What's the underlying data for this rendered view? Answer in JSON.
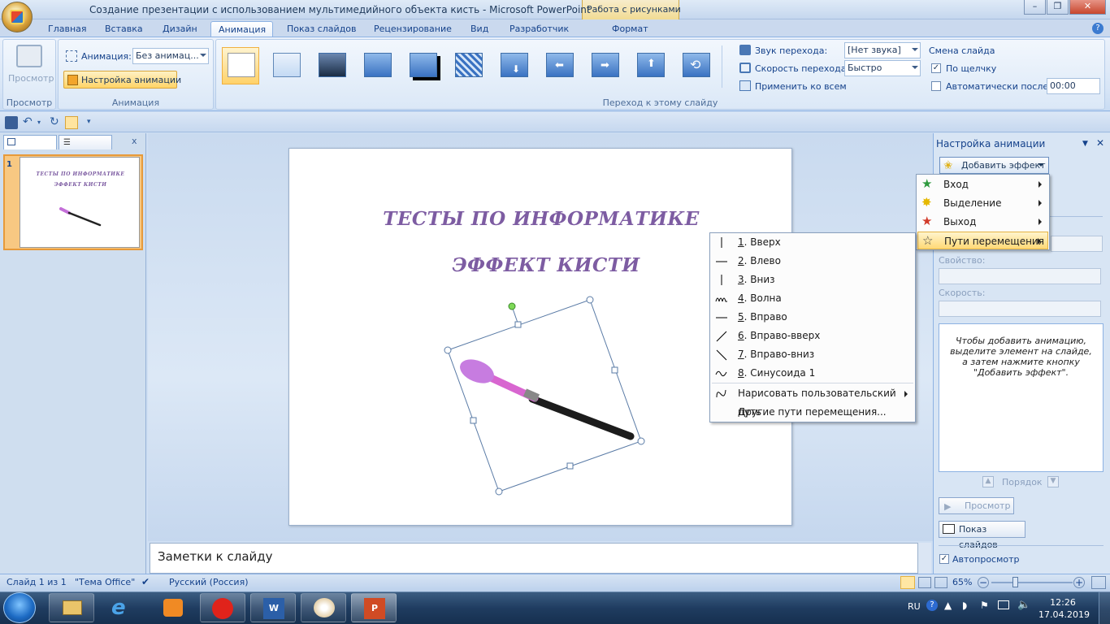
{
  "window": {
    "title": "Создание презентации с использованием мультимедийного объекта кисть - Microsoft PowerPoint",
    "context_tab_group": "Работа с рисунками",
    "controls": {
      "minimize": "–",
      "maximize": "❐",
      "close": "✕"
    }
  },
  "tabs": [
    "Главная",
    "Вставка",
    "Дизайн",
    "Анимация",
    "Показ слайдов",
    "Рецензирование",
    "Вид",
    "Разработчик",
    "Формат"
  ],
  "active_tab": "Анимация",
  "ribbon": {
    "preview_group": {
      "button_label": "Просмотр",
      "group_label": "Просмотр"
    },
    "animation_group": {
      "animation_label": "Анимация:",
      "animation_value": "Без анимац...",
      "custom_animation_button": "Настройка анимации",
      "group_label": "Анимация"
    },
    "transition_group": {
      "group_label": "Переход к этому слайду",
      "sound_label": "Звук перехода:",
      "sound_value": "[Нет звука]",
      "speed_label": "Скорость перехода:",
      "speed_value": "Быстро",
      "apply_all": "Применить ко всем"
    },
    "advance_group": {
      "title": "Смена слайда",
      "on_click": "По щелчку",
      "on_click_checked": true,
      "auto_after": "Автоматически после:",
      "auto_after_checked": false,
      "auto_time": "00:00"
    }
  },
  "slides_pane": {
    "close": "x",
    "slide_number": "1"
  },
  "slide": {
    "title1": "ТЕСТЫ ПО ИНФОРМАТИКЕ",
    "title2": "ЭФФЕКТ КИСТИ"
  },
  "notes": {
    "placeholder": "Заметки к слайду"
  },
  "task_pane": {
    "title": "Настройка анимации",
    "add_effect": "Добавить эффект",
    "property_label": "Свойство:",
    "speed_label": "Скорость:",
    "hint": "Чтобы добавить анимацию, выделите элемент на слайде, а затем нажмите кнопку \"Добавить эффект\".",
    "order_label": "Порядок",
    "preview_button": "Просмотр",
    "slideshow_button": "Показ слайдов",
    "autopreview_label": "Автопросмотр",
    "autopreview_checked": true
  },
  "effect_menu": [
    {
      "label": "Вход",
      "icon": "green-star-icon",
      "color": "#2e9a3e"
    },
    {
      "label": "Выделение",
      "icon": "yellow-star-icon",
      "color": "#e5b800"
    },
    {
      "label": "Выход",
      "icon": "red-star-icon",
      "color": "#d23b2a"
    },
    {
      "label": "Пути перемещения",
      "icon": "outline-star-icon",
      "color": "#444444",
      "highlighted": true
    }
  ],
  "motion_path_menu": [
    {
      "num": "1",
      "label": ". Вверх",
      "icon": "line-up-icon"
    },
    {
      "num": "2",
      "label": ". Влево",
      "icon": "line-left-icon"
    },
    {
      "num": "3",
      "label": ". Вниз",
      "icon": "line-down-icon"
    },
    {
      "num": "4",
      "label": ". Волна",
      "icon": "wave-icon"
    },
    {
      "num": "5",
      "label": ". Вправо",
      "icon": "line-right-icon"
    },
    {
      "num": "6",
      "label": ". Вправо-вверх",
      "icon": "diagonal-up-icon"
    },
    {
      "num": "7",
      "label": ". Вправо-вниз",
      "icon": "diagonal-down-icon"
    },
    {
      "num": "8",
      "label": ". Синусоида 1",
      "icon": "sine-icon"
    }
  ],
  "motion_path_extra": {
    "draw_custom": "Нарисовать пользовательский путь",
    "more_paths": "Другие пути перемещения..."
  },
  "status_bar": {
    "slide_info": "Слайд 1 из 1",
    "theme": "\"Тема Office\"",
    "language": "Русский (Россия)",
    "zoom": "65%"
  },
  "taskbar": {
    "language": "RU",
    "time": "12:26",
    "date": "17.04.2019"
  }
}
